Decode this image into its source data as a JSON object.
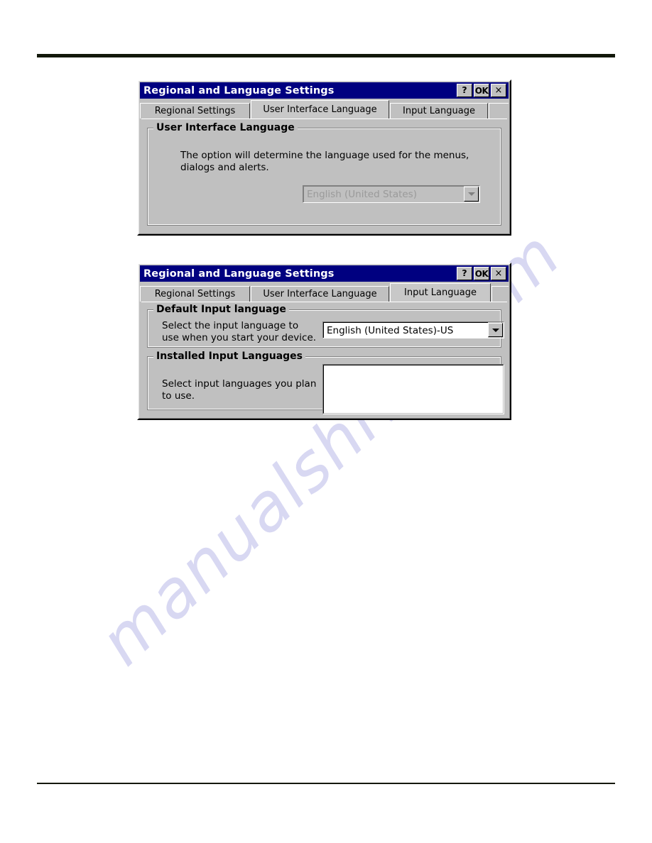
{
  "page": {
    "background": "#ffffff",
    "rule_color": "#12180a",
    "watermark": "manualshive.com",
    "watermark_color": "#d8d8f2"
  },
  "dialog1": {
    "title": "Regional and Language Settings",
    "titlebar_color": "#000080",
    "buttons": {
      "help": "?",
      "ok": "OK",
      "close": "×"
    },
    "tabs": [
      {
        "label": "Regional Settings",
        "selected": false
      },
      {
        "label": "User Interface Language",
        "selected": true
      },
      {
        "label": "Input Language",
        "selected": false
      }
    ],
    "group": {
      "title": "User Interface Language",
      "description": "The option will determine the language used for the menus, dialogs and alerts."
    },
    "combo": {
      "value": "English (United States)",
      "enabled": false
    }
  },
  "dialog2": {
    "title": "Regional and Language Settings",
    "titlebar_color": "#000080",
    "buttons": {
      "help": "?",
      "ok": "OK",
      "close": "×"
    },
    "tabs": [
      {
        "label": "Regional Settings",
        "selected": false
      },
      {
        "label": "User Interface Language",
        "selected": false
      },
      {
        "label": "Input Language",
        "selected": true
      }
    ],
    "group_default": {
      "title": "Default Input language",
      "description": "Select the input language to\nuse when you start your device.",
      "combo": {
        "value": "English (United States)-US",
        "enabled": true
      }
    },
    "group_installed": {
      "title": "Installed Input Languages",
      "description": "Select input languages you plan\nto use.",
      "listbox_items": []
    }
  }
}
